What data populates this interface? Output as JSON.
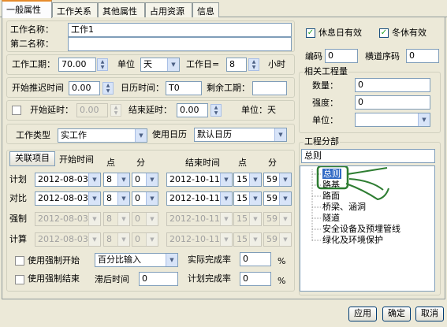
{
  "tabs": [
    "一般属性",
    "工作关系",
    "其他属性",
    "占用资源",
    "信息"
  ],
  "work_name_label": "工作名称：",
  "work_name_value": "工作1",
  "second_name_label": "第二名称：",
  "second_name_value": "",
  "duration_label": "工作工期：",
  "duration_value": "70.00",
  "unit_label": "单位",
  "unit_value": "天",
  "workday_label": "工作日=",
  "workday_value": "8",
  "hours_label": "小时",
  "start_delay_label": "开始推迟时间",
  "start_delay_value": "0.00",
  "calendar_time_label": "日历时间：",
  "calendar_time_value": "T0",
  "remaining_label": "剩余工期：",
  "remaining_value": "",
  "start_lag_label": "开始延时：",
  "start_lag_value": "0.00",
  "end_lag_label": "结束延时：",
  "end_lag_value": "0.00",
  "unit_day_text": "单位：天",
  "work_type_label": "工作类型",
  "work_type_value": "实工作",
  "use_calendar_label": "使用日历",
  "use_calendar_value": "默认日历",
  "related_btn": "关联项目",
  "start_time_header": "开始时间",
  "end_time_header": "结束时间",
  "point_label": "点",
  "minute_label": "分",
  "rows": [
    {
      "label": "计划",
      "start": "2012-08-03",
      "sh": "8",
      "sm": "0",
      "end": "2012-10-11",
      "eh": "15",
      "em": "59",
      "disabled": false
    },
    {
      "label": "对比",
      "start": "2012-08-03",
      "sh": "8",
      "sm": "0",
      "end": "2012-10-11",
      "eh": "15",
      "em": "59",
      "disabled": false
    },
    {
      "label": "强制",
      "start": "2012-08-03",
      "sh": "8",
      "sm": "0",
      "end": "2012-10-11",
      "eh": "15",
      "em": "59",
      "disabled": true
    },
    {
      "label": "计算",
      "start": "2012-08-03",
      "sh": "8",
      "sm": "0",
      "end": "2012-10-11",
      "eh": "15",
      "em": "59",
      "disabled": true
    }
  ],
  "force_start_label": "使用强制开始",
  "force_end_label": "使用强制结束",
  "percent_input_value": "百分比输入",
  "actual_rate_label": "实际完成率",
  "actual_rate_value": "0",
  "planned_rate_label": "计划完成率",
  "planned_rate_value": "0",
  "lag_time_label": "滞后时间",
  "lag_time_value": "0",
  "percent_sign": "%",
  "holiday_label": "休息日有效",
  "winter_label": "冬休有效",
  "code_label": "编码",
  "code_value": "0",
  "crossing_label": "横道序码",
  "crossing_value": "0",
  "quantity_group": "相关工程量",
  "quantity_label": "数量：",
  "quantity_value": "0",
  "intensity_label": "强度：",
  "intensity_value": "0",
  "qunit_label": "单位：",
  "qunit_value": "",
  "division_group": "工程分部",
  "division_value": "总则",
  "tree_items": [
    "总则",
    "路基",
    "路面",
    "桥梁、涵洞",
    "隧道",
    "安全设备及预埋管线",
    "绿化及环境保护"
  ],
  "apply_btn": "应用",
  "ok_btn": "确定",
  "cancel_btn": "取消"
}
